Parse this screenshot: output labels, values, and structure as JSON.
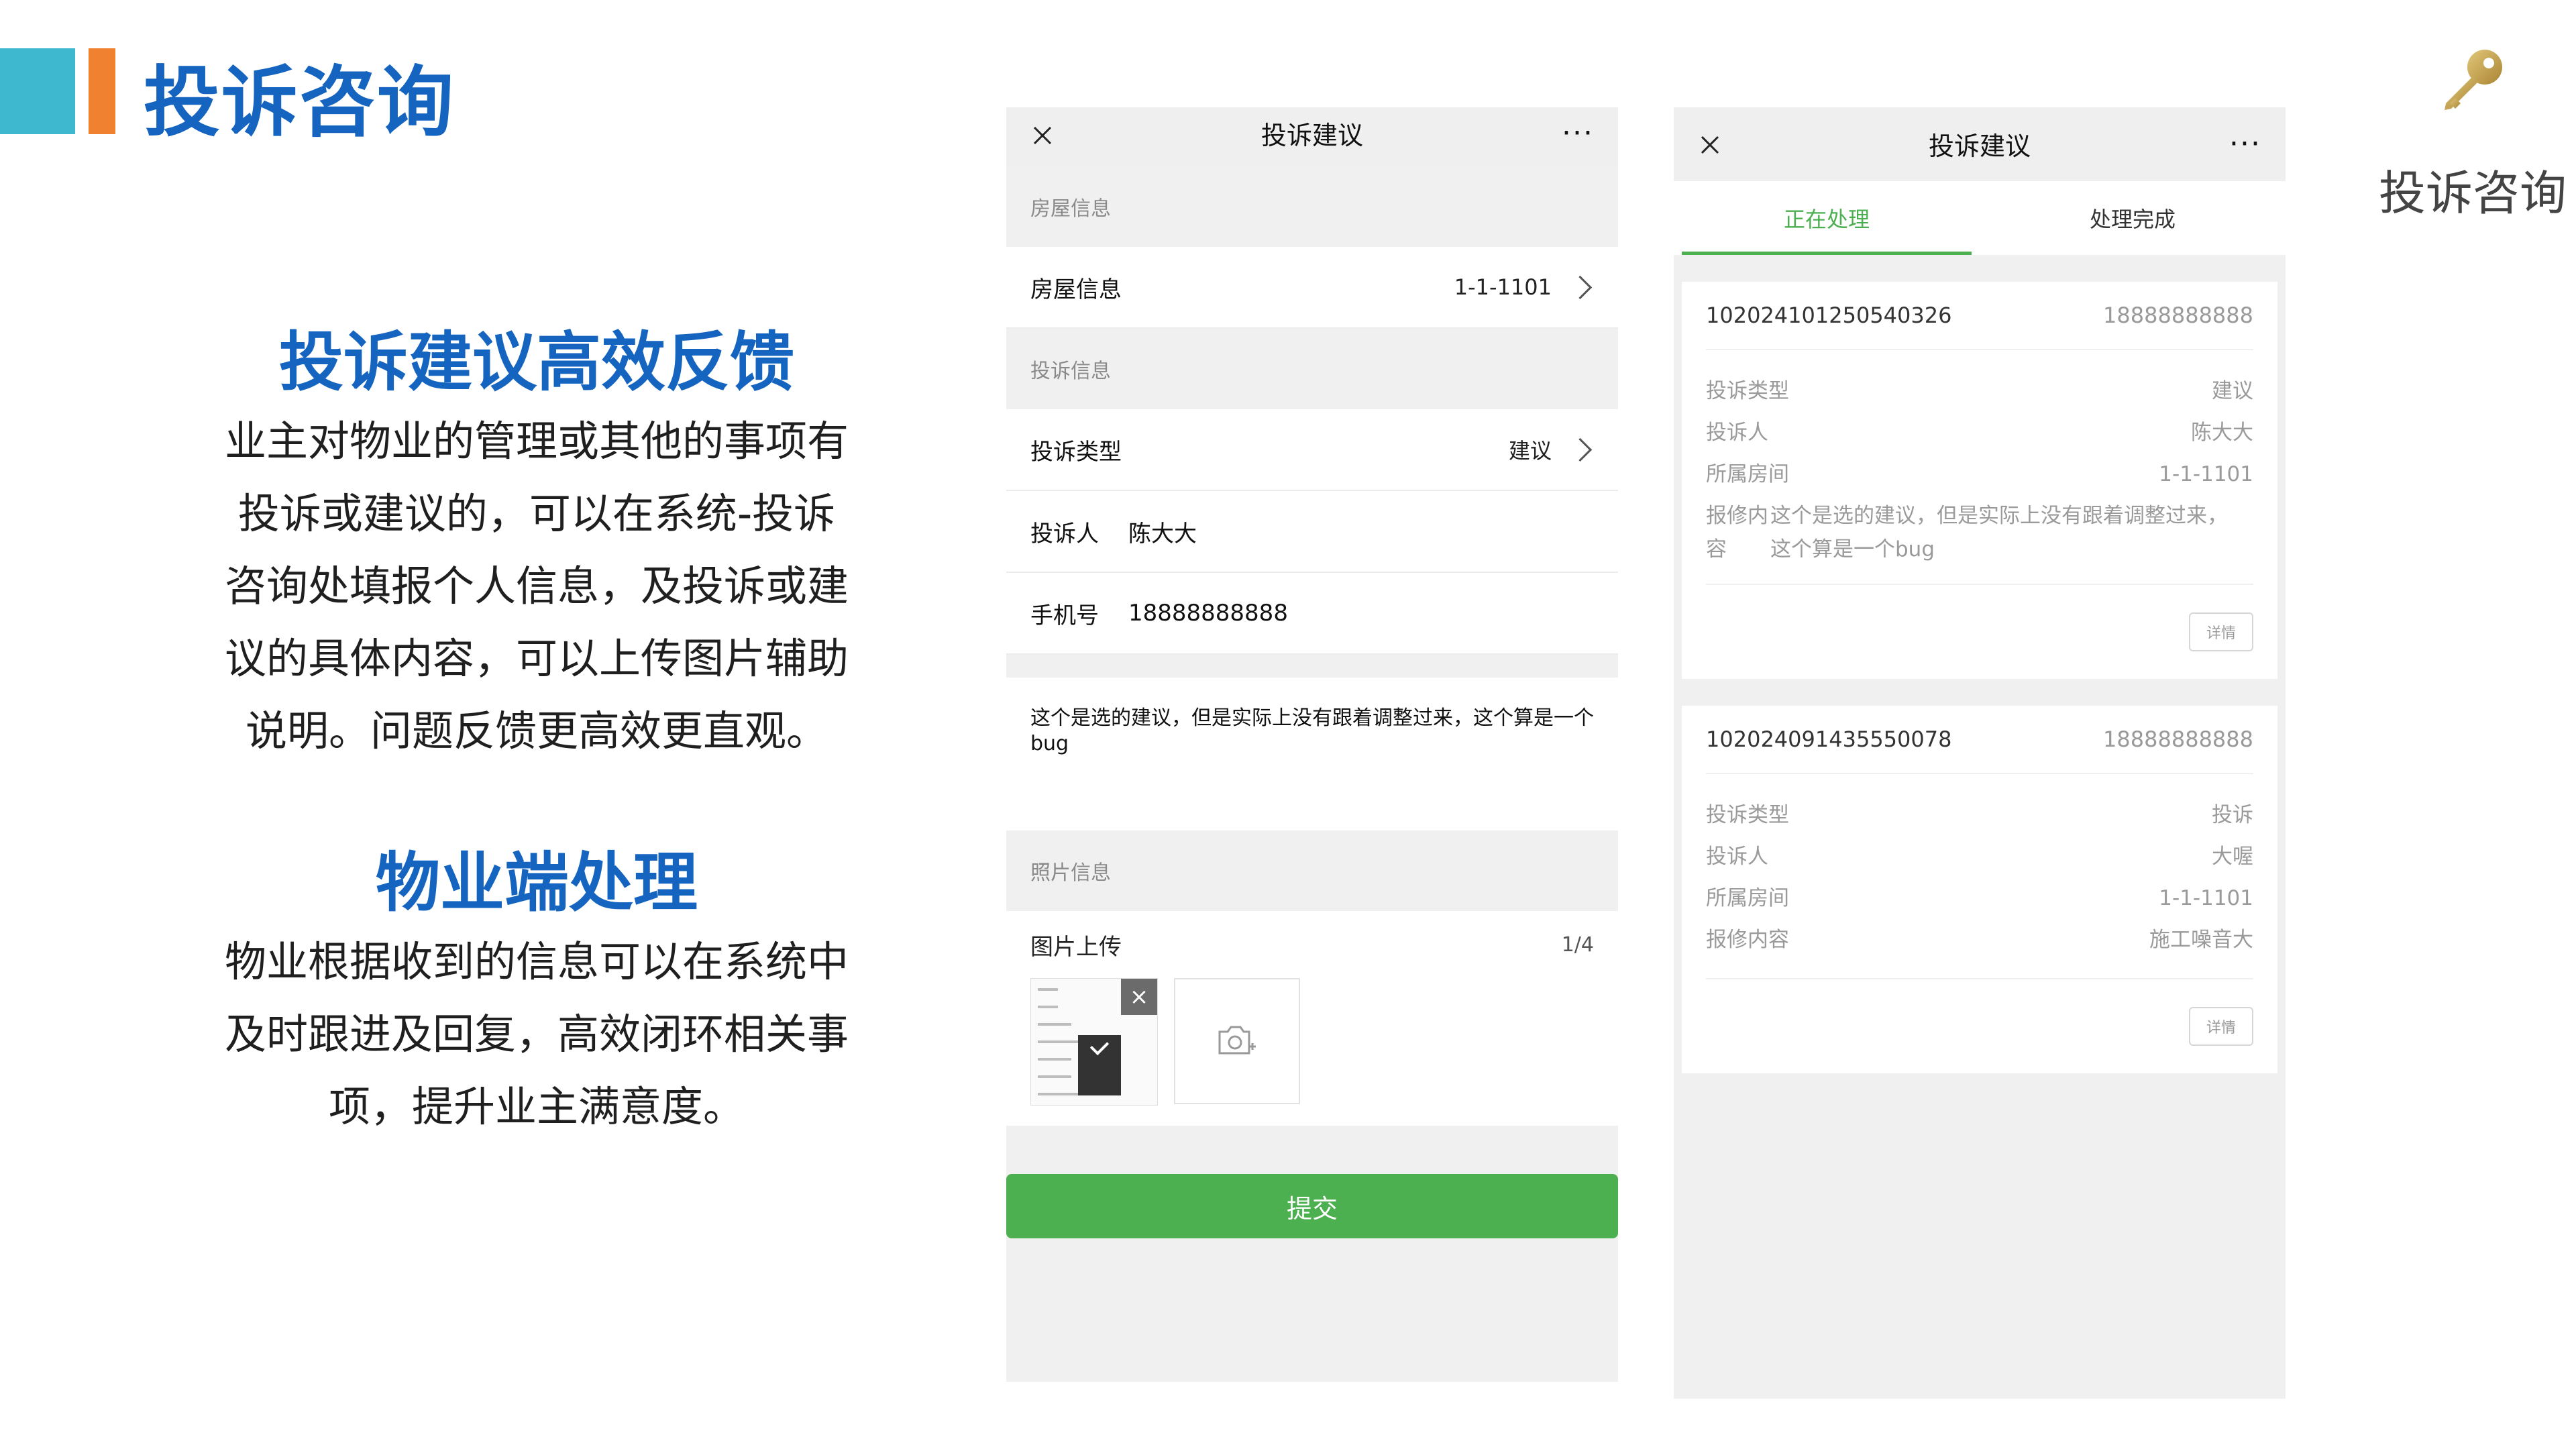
{
  "header": {
    "title": "投诉咨询"
  },
  "left": {
    "section1": {
      "title": "投诉建议高效反馈",
      "lines": [
        "业主对物业的管理或其他的事项有",
        "投诉或建议的，可以在系统-投诉",
        "咨询处填报个人信息，及投诉或建",
        "议的具体内容，可以上传图片辅助",
        "说明。问题反馈更高效更直观。"
      ]
    },
    "section2": {
      "title": "物业端处理",
      "lines": [
        "物业根据收到的信息可以在系统中",
        "及时跟进及回复，高效闭环相关事",
        "项，提升业主满意度。"
      ]
    }
  },
  "phone_a": {
    "title": "投诉建议",
    "more": "···",
    "group_house": "房屋信息",
    "house_label": "房屋信息",
    "house_value": "1-1-1101",
    "group_complaint": "投诉信息",
    "type_label": "投诉类型",
    "type_value": "建议",
    "person_label": "投诉人",
    "person_value": "陈大大",
    "phone_label": "手机号",
    "phone_value": "18888888888",
    "content": "这个是选的建议，但是实际上没有跟着调整过来，这个算是一个bug",
    "group_photo": "照片信息",
    "upload_label": "图片上传",
    "upload_count": "1/4",
    "submit": "提交"
  },
  "phone_b": {
    "title": "投诉建议",
    "more": "···",
    "tabs": [
      "正在处理",
      "处理完成"
    ],
    "cards": [
      {
        "id": "102024101250540326",
        "phone": "18888888888",
        "type_label": "投诉类型",
        "type_value": "建议",
        "person_label": "投诉人",
        "person_value": "陈大大",
        "room_label": "所属房间",
        "room_value": "1-1-1101",
        "content_label_1": "报修内",
        "content_label_2": "容",
        "content_line_1": "这个是选的建议，但是实际上没有跟着调整过来，",
        "content_line_2": "这个算是一个bug",
        "detail": "详情"
      },
      {
        "id": "102024091435550078",
        "phone": "18888888888",
        "type_label": "投诉类型",
        "type_value": "投诉",
        "person_label": "投诉人",
        "person_value": "大喔",
        "room_label": "所属房间",
        "room_value": "1-1-1101",
        "content_label": "报修内容",
        "content_value": "施工噪音大",
        "detail": "详情"
      }
    ]
  },
  "right": {
    "label": "投诉咨询",
    "icon": "key-icon"
  },
  "colors": {
    "brand_blue": "#1565c0",
    "accent_cyan": "#3db8cf",
    "accent_orange": "#f08131",
    "green": "#4caf50"
  }
}
